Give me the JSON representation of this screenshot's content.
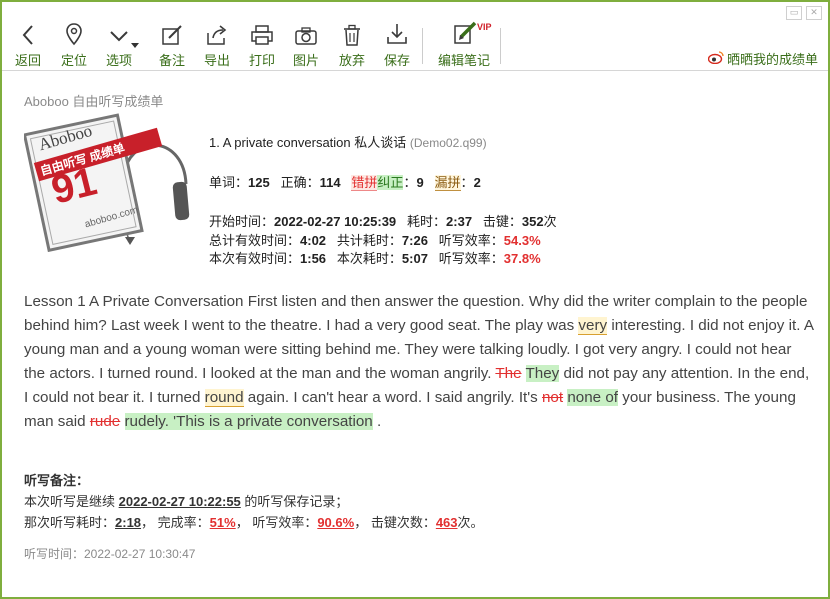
{
  "toolbar": {
    "items": [
      {
        "label": "返回",
        "icon": "back-icon"
      },
      {
        "label": "定位",
        "icon": "location-pin-icon"
      },
      {
        "label": "选项",
        "icon": "chevron-down-icon"
      },
      {
        "label": "备注",
        "icon": "edit-note-icon"
      },
      {
        "label": "导出",
        "icon": "export-icon"
      },
      {
        "label": "打印",
        "icon": "print-icon"
      },
      {
        "label": "图片",
        "icon": "camera-icon"
      },
      {
        "label": "放弃",
        "icon": "trash-icon"
      },
      {
        "label": "保存",
        "icon": "download-icon"
      },
      {
        "label": "编辑笔记",
        "icon": "edit-notes-icon"
      }
    ],
    "vip_badge": "VIP",
    "share_label": "晒晒我的成绩单"
  },
  "section_title": "Aboboo 自由听写成绩单",
  "logo": {
    "brand": "Aboboo",
    "subtitle": "自由听写 成绩单",
    "score": "91",
    "site": "aboboo.com"
  },
  "result": {
    "title": "1. A private conversation 私人谈话",
    "file": "(Demo02.q99)",
    "words_label": "单词：",
    "words": "125",
    "correct_label": "正确：",
    "correct": "114",
    "err_label_a": "错拼",
    "err_label_b": "纠正",
    "err_sep": "：",
    "err_count": "9",
    "miss_label": "漏拼",
    "miss_sep": "：",
    "miss_count": "2",
    "start_label": "开始时间：",
    "start": "2022-02-27 10:25:39",
    "elapsed_label": "耗时：",
    "elapsed": "2:37",
    "keys_label": "击键：",
    "keys": "352",
    "keys_unit": "次",
    "total_eff_label": "总计有效时间：",
    "total_eff": "4:02",
    "total_time_label": "共计耗时：",
    "total_time": "7:26",
    "total_rate_label": "听写效率：",
    "total_rate": "54.3%",
    "this_eff_label": "本次有效时间：",
    "this_eff": "1:56",
    "this_time_label": "本次耗时：",
    "this_time": "5:07",
    "this_rate_label": "听写效率：",
    "this_rate": "37.8%"
  },
  "passage": {
    "p1": "Lesson 1 A Private Conversation First listen and then answer the question. Why did the writer complain to the people behind him? Last week I went to the theatre. I had a very good seat. The play was ",
    "w_very": "very",
    "p2": " interesting. I did not enjoy it. A young man and a young woman were sitting behind me. They were talking loudly. I got very angry. I could not hear the actors. I turned round. I looked at the man and the woman angrily. ",
    "s_the": "The",
    "p3": " ",
    "g_they": "They",
    "p4": " did not pay any attention. In the end, I could not bear it. I turned ",
    "w_round": "round",
    "p5": " again. I can't hear a word. I said angrily. It's ",
    "s_not": "not",
    "p6": " ",
    "g_noneof": "none of",
    "p7": " your business. The young man said ",
    "s_rude": "rude",
    "p8": " ",
    "g_rudely": "rudely. 'This is a private conversation",
    "p9": " ."
  },
  "notes": {
    "heading": "听写备注：",
    "line1_a": "本次听写是继续 ",
    "line1_time": "2022-02-27 10:22:55",
    "line1_b": " 的听写保存记录；",
    "line2_a": "那次听写耗时：",
    "line2_time": "2:18",
    "line2_b": "，  完成率：",
    "line2_rate": "51%",
    "line2_c": "，  听写效率：",
    "line2_eff": "90.6%",
    "line2_d": "，  击键次数：",
    "line2_keys": "463",
    "line2_e": "次。"
  },
  "footer": "听写时间：2022-02-27 10:30:47",
  "colors": {
    "accent": "#7fae3e",
    "label": "#3a6e1a",
    "error": "#e23030",
    "fix": "#c8f0c4"
  }
}
